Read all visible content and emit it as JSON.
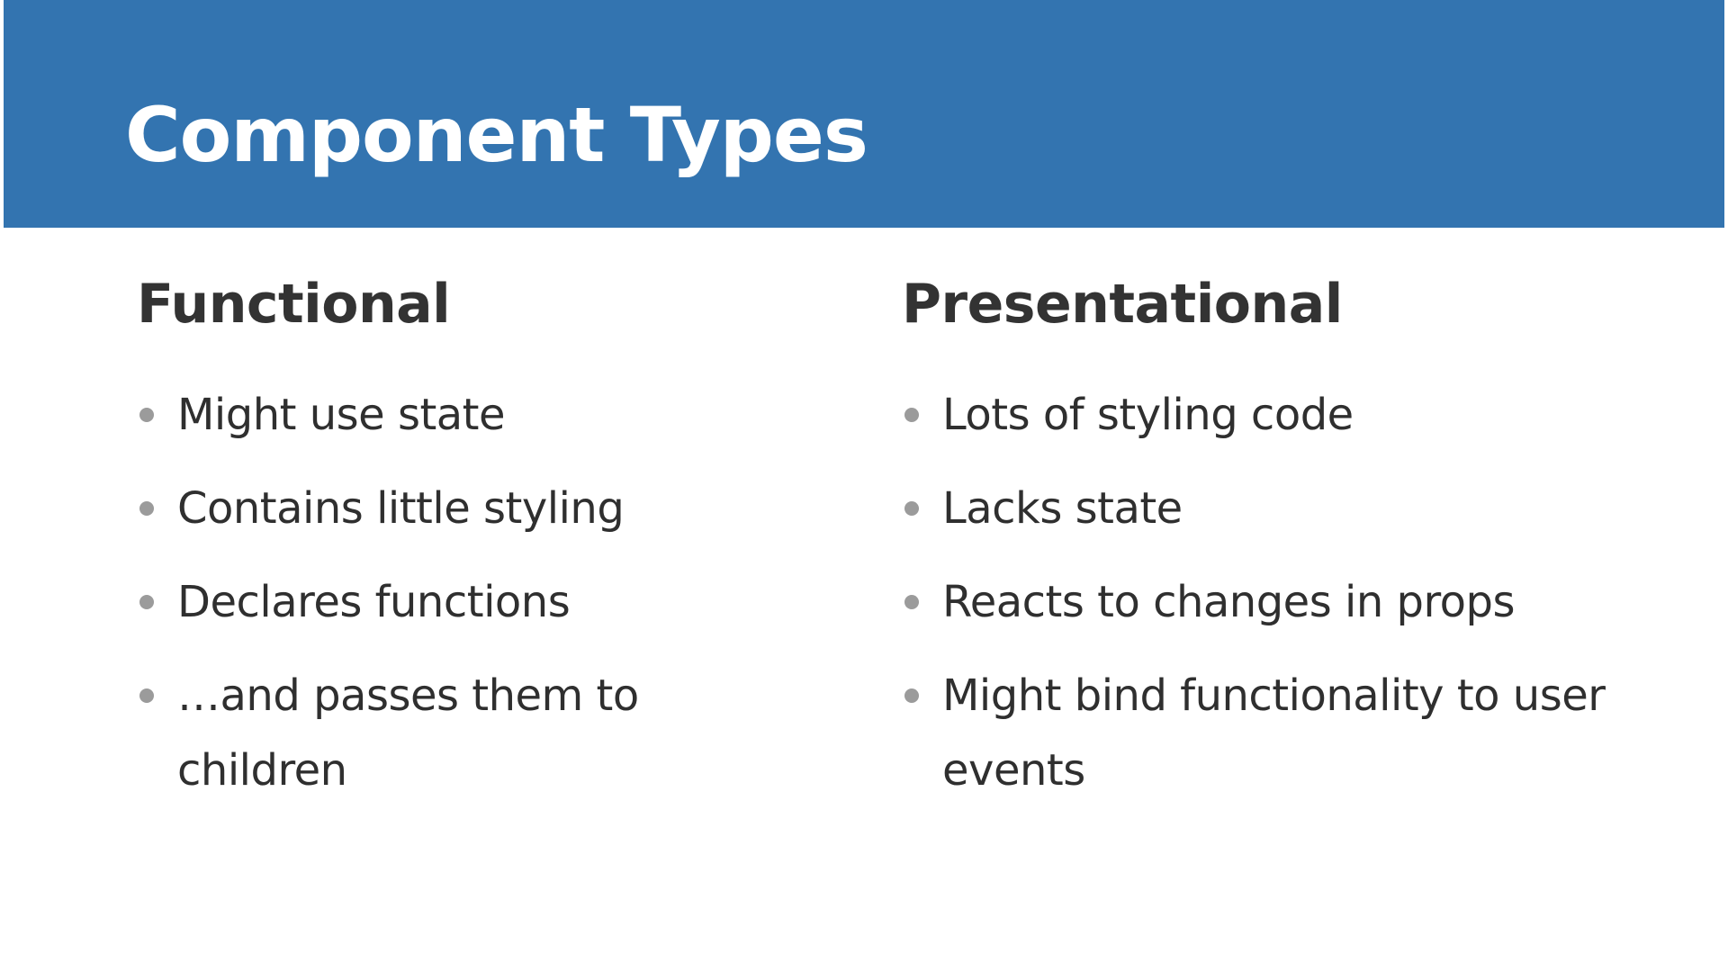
{
  "slide": {
    "title": "Component Types",
    "colors": {
      "title_band": "#3374b0",
      "title_text": "#ffffff",
      "body_text": "#333333",
      "bullet": "#9b9b9b"
    },
    "columns": [
      {
        "heading": "Functional",
        "bullets": [
          "Might use state",
          "Contains little styling",
          "Declares functions",
          "…and passes them to children"
        ]
      },
      {
        "heading": "Presentational",
        "bullets": [
          "Lots of styling code",
          "Lacks state",
          "Reacts to changes in props",
          "Might bind functionality to user events"
        ]
      }
    ]
  }
}
